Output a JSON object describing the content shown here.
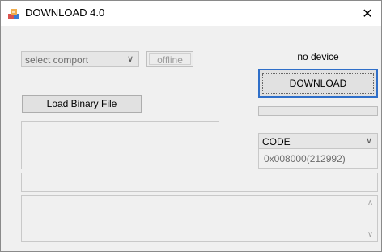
{
  "window": {
    "title": "DOWNLOAD 4.0",
    "close_symbol": "✕",
    "app_icon": "app-icon"
  },
  "port": {
    "placeholder": "select comport",
    "dropdown_icon": "chevron-down-icon"
  },
  "connection": {
    "status_button_label": "offline"
  },
  "device": {
    "status_text": "no device"
  },
  "download": {
    "button_label": "DOWNLOAD",
    "progress": 0
  },
  "binary": {
    "load_button_label": "Load Binary File"
  },
  "memory": {
    "region_selected": "CODE",
    "address": "0x008000(212992)"
  },
  "log": {
    "scroll_up_icon": "scroll-up-icon",
    "scroll_down_icon": "scroll-down-icon"
  },
  "colors": {
    "accent": "#2f6fc9",
    "background": "#f0f0f0"
  }
}
